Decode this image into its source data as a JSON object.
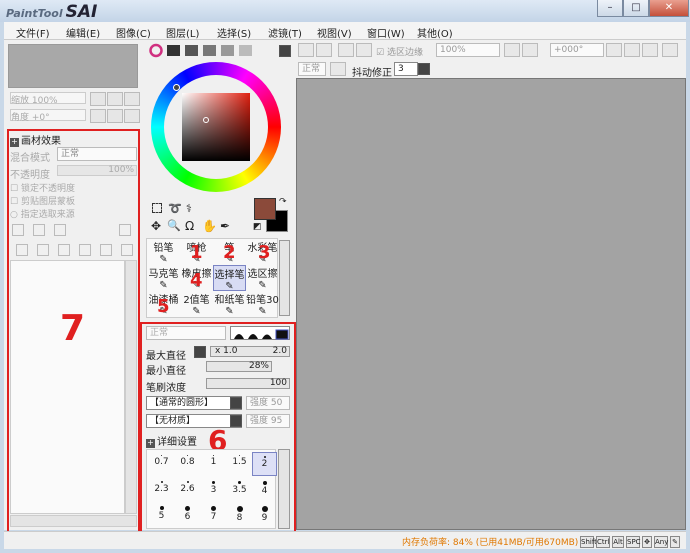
{
  "app": {
    "name_small": "PaintTool",
    "name_big": "SAI"
  },
  "window_buttons": {
    "minimize": "–",
    "maximize": "□",
    "close": "✕"
  },
  "menu": [
    "文件(F)",
    "编辑(E)",
    "图像(C)",
    "图层(L)",
    "选择(S)",
    "滤镜(T)",
    "视图(V)",
    "窗口(W)",
    "其他(O)"
  ],
  "left": {
    "zoom_label": "缩放 100%",
    "angle_label": "角度 +0°",
    "section_title": "画材效果",
    "blend_label": "混合模式",
    "blend_value": "正常",
    "opacity_label": "不透明度",
    "opacity_value": "100%",
    "checkboxes": [
      "锁定不透明度",
      "剪贴图层蒙板",
      "指定选取来源"
    ],
    "annotation": "7"
  },
  "toolbar": {
    "selection_edge": "选区边缘",
    "zoom_value": "100%",
    "angle_value": "+000°",
    "blend_mode": "正常",
    "stabilizer_label": "抖动修正",
    "stabilizer_value": "3"
  },
  "tools": {
    "rows": [
      [
        "铅笔",
        "喷枪",
        "笔",
        "水彩笔"
      ],
      [
        "马克笔",
        "橡皮擦",
        "选择笔",
        "选区擦"
      ],
      [
        "油漆桶",
        "2值笔",
        "和纸笔",
        "铅笔30"
      ]
    ],
    "selected": "选择笔",
    "annotations": [
      "1",
      "2",
      "3",
      "4",
      "5"
    ]
  },
  "brush": {
    "mode_value": "正常",
    "max_size_label": "最大直径",
    "max_size_mult": "x 1.0",
    "max_size_value": "2.0",
    "min_size_label": "最小直径",
    "min_size_value": "28%",
    "density_label": "笔刷浓度",
    "density_value": "100",
    "shape_value": "【通常的圆形】",
    "shape_strength_label": "强度",
    "shape_strength_value": "50",
    "texture_value": "【无材质】",
    "texture_strength_label": "强度",
    "texture_strength_value": "95",
    "details_label": "详细设置",
    "sizes": [
      [
        "0.7",
        "0.8",
        "1",
        "1.5",
        "2"
      ],
      [
        "2.3",
        "2.6",
        "3",
        "3.5",
        "4"
      ],
      [
        "5",
        "6",
        "7",
        "8",
        "9"
      ]
    ],
    "selected_size": "2",
    "annotation": "6"
  },
  "status": {
    "memory": "内存负荷率: 84% (已用41MB/可用670MB)",
    "keys": [
      "Shift",
      "Ctrl",
      "Alt",
      "SPC",
      "✥",
      "Any",
      "✎"
    ]
  },
  "colors": {
    "primary": "#8b4a3a",
    "secondary": "#000000",
    "accent_red": "#e02020",
    "memory_text": "#e07800"
  }
}
